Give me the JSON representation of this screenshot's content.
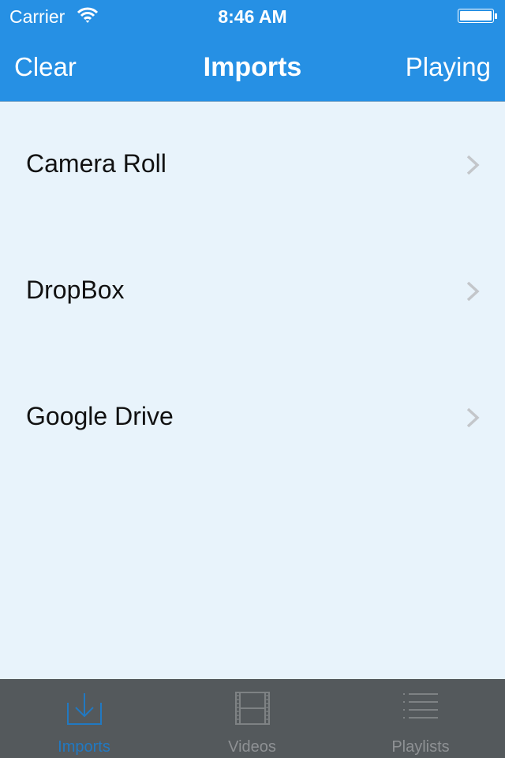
{
  "status_bar": {
    "carrier": "Carrier",
    "time": "8:46 AM",
    "wifi_icon": "wifi-icon",
    "battery_icon": "battery-icon"
  },
  "nav": {
    "left_button": "Clear",
    "title": "Imports",
    "right_button": "Playing"
  },
  "list": {
    "items": [
      {
        "label": "Camera Roll",
        "icon": "chevron-right-icon"
      },
      {
        "label": "DropBox",
        "icon": "chevron-right-icon"
      },
      {
        "label": "Google Drive",
        "icon": "chevron-right-icon"
      }
    ]
  },
  "tabbar": {
    "tabs": [
      {
        "label": "Imports",
        "icon": "download-tray-icon",
        "active": true
      },
      {
        "label": "Videos",
        "icon": "film-strip-icon",
        "active": false
      },
      {
        "label": "Playlists",
        "icon": "list-icon",
        "active": false
      }
    ]
  },
  "colors": {
    "accent": "#2690e4",
    "background": "#e8f3fb",
    "tabbar": "#54595c",
    "tab_active": "#2179c2",
    "tab_inactive": "#8e9194"
  }
}
